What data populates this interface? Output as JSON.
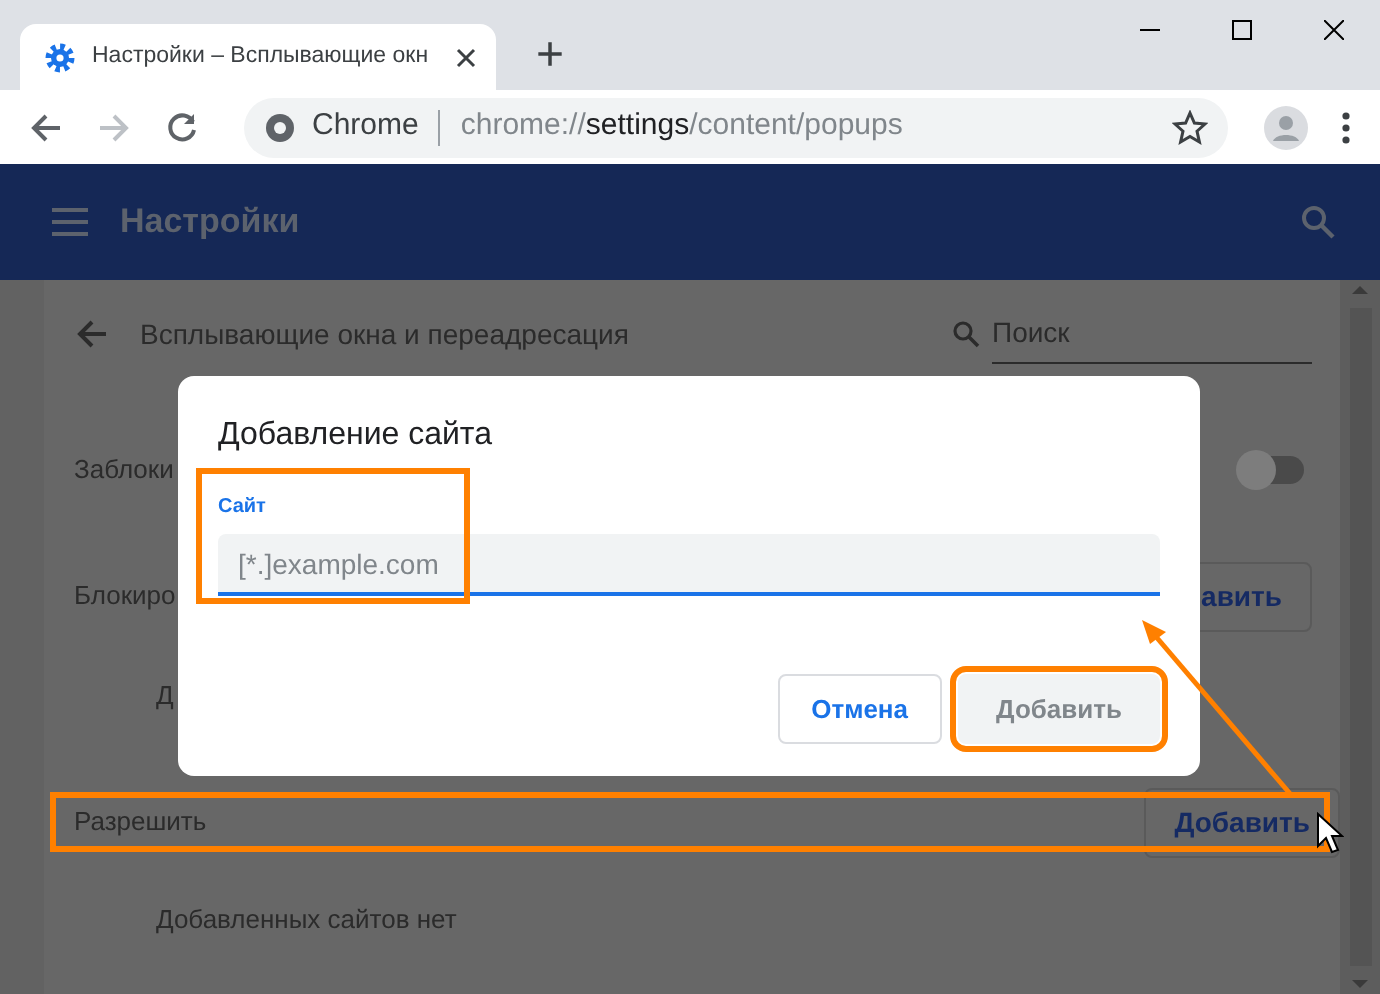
{
  "browser": {
    "tabs": [
      {
        "title": "Настройки – Всплывающие окн",
        "selected": true
      }
    ],
    "new_tab": "+",
    "nav": {
      "forward_disabled": true
    },
    "address": {
      "scheme_label": "Chrome",
      "url_prefix": "chrome://",
      "url_host": "settings",
      "url_path": "/content/popups"
    }
  },
  "settings_header": {
    "title": "Настройки"
  },
  "page": {
    "title": "Всплывающие окна и переадресация",
    "search_placeholder": "Поиск",
    "rows": [
      {
        "kind": "toggle",
        "label": "Заблоки",
        "on": false
      },
      {
        "kind": "section",
        "label": "Блокиро",
        "button": "авить",
        "highlighted": false
      },
      {
        "kind": "empty",
        "label": "Д"
      },
      {
        "kind": "section",
        "label": "Разрешить",
        "button": "Добавить",
        "highlighted": true
      },
      {
        "kind": "empty",
        "label": "Добавленных сайтов нет"
      }
    ]
  },
  "dialog": {
    "title": "Добавление сайта",
    "field": {
      "label": "Сайт",
      "placeholder": "[*.]example.com",
      "highlighted": true
    },
    "buttons": [
      {
        "label": "Отмена",
        "kind": "cancel",
        "disabled": false,
        "highlighted": false
      },
      {
        "label": "Добавить",
        "kind": "action",
        "disabled": true,
        "highlighted": true
      }
    ]
  }
}
